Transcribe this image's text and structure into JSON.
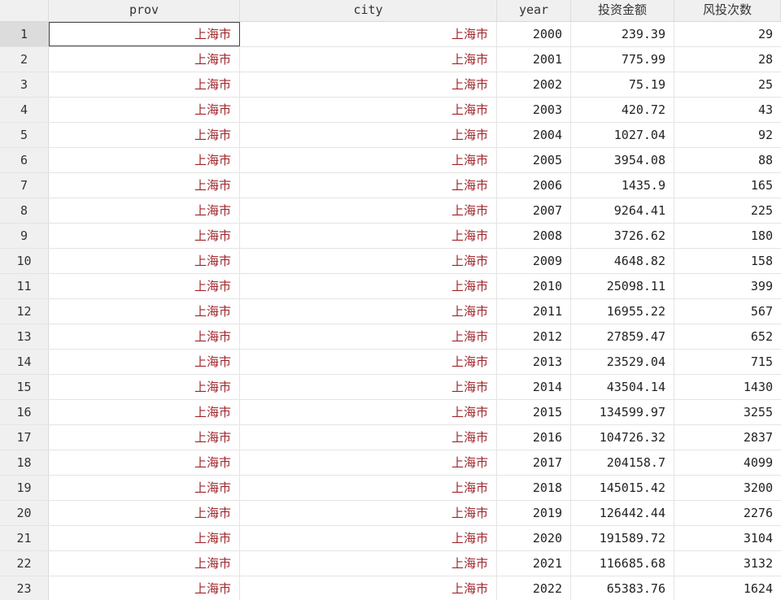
{
  "columns": {
    "prov": "prov",
    "city": "city",
    "year": "year",
    "amount": "投资金额",
    "count": "风投次数"
  },
  "rows": [
    {
      "n": "1",
      "prov": "上海市",
      "city": "上海市",
      "year": "2000",
      "amount": "239.39",
      "count": "29"
    },
    {
      "n": "2",
      "prov": "上海市",
      "city": "上海市",
      "year": "2001",
      "amount": "775.99",
      "count": "28"
    },
    {
      "n": "3",
      "prov": "上海市",
      "city": "上海市",
      "year": "2002",
      "amount": "75.19",
      "count": "25"
    },
    {
      "n": "4",
      "prov": "上海市",
      "city": "上海市",
      "year": "2003",
      "amount": "420.72",
      "count": "43"
    },
    {
      "n": "5",
      "prov": "上海市",
      "city": "上海市",
      "year": "2004",
      "amount": "1027.04",
      "count": "92"
    },
    {
      "n": "6",
      "prov": "上海市",
      "city": "上海市",
      "year": "2005",
      "amount": "3954.08",
      "count": "88"
    },
    {
      "n": "7",
      "prov": "上海市",
      "city": "上海市",
      "year": "2006",
      "amount": "1435.9",
      "count": "165"
    },
    {
      "n": "8",
      "prov": "上海市",
      "city": "上海市",
      "year": "2007",
      "amount": "9264.41",
      "count": "225"
    },
    {
      "n": "9",
      "prov": "上海市",
      "city": "上海市",
      "year": "2008",
      "amount": "3726.62",
      "count": "180"
    },
    {
      "n": "10",
      "prov": "上海市",
      "city": "上海市",
      "year": "2009",
      "amount": "4648.82",
      "count": "158"
    },
    {
      "n": "11",
      "prov": "上海市",
      "city": "上海市",
      "year": "2010",
      "amount": "25098.11",
      "count": "399"
    },
    {
      "n": "12",
      "prov": "上海市",
      "city": "上海市",
      "year": "2011",
      "amount": "16955.22",
      "count": "567"
    },
    {
      "n": "13",
      "prov": "上海市",
      "city": "上海市",
      "year": "2012",
      "amount": "27859.47",
      "count": "652"
    },
    {
      "n": "14",
      "prov": "上海市",
      "city": "上海市",
      "year": "2013",
      "amount": "23529.04",
      "count": "715"
    },
    {
      "n": "15",
      "prov": "上海市",
      "city": "上海市",
      "year": "2014",
      "amount": "43504.14",
      "count": "1430"
    },
    {
      "n": "16",
      "prov": "上海市",
      "city": "上海市",
      "year": "2015",
      "amount": "134599.97",
      "count": "3255"
    },
    {
      "n": "17",
      "prov": "上海市",
      "city": "上海市",
      "year": "2016",
      "amount": "104726.32",
      "count": "2837"
    },
    {
      "n": "18",
      "prov": "上海市",
      "city": "上海市",
      "year": "2017",
      "amount": "204158.7",
      "count": "4099"
    },
    {
      "n": "19",
      "prov": "上海市",
      "city": "上海市",
      "year": "2018",
      "amount": "145015.42",
      "count": "3200"
    },
    {
      "n": "20",
      "prov": "上海市",
      "city": "上海市",
      "year": "2019",
      "amount": "126442.44",
      "count": "2276"
    },
    {
      "n": "21",
      "prov": "上海市",
      "city": "上海市",
      "year": "2020",
      "amount": "191589.72",
      "count": "3104"
    },
    {
      "n": "22",
      "prov": "上海市",
      "city": "上海市",
      "year": "2021",
      "amount": "116685.68",
      "count": "3132"
    },
    {
      "n": "23",
      "prov": "上海市",
      "city": "上海市",
      "year": "2022",
      "amount": "65383.76",
      "count": "1624"
    }
  ],
  "colors": {
    "string_text": "#a0262b",
    "numeric_text": "#222222",
    "header_bg": "#f0f0f0",
    "grid_line": "#e4e4e4"
  }
}
